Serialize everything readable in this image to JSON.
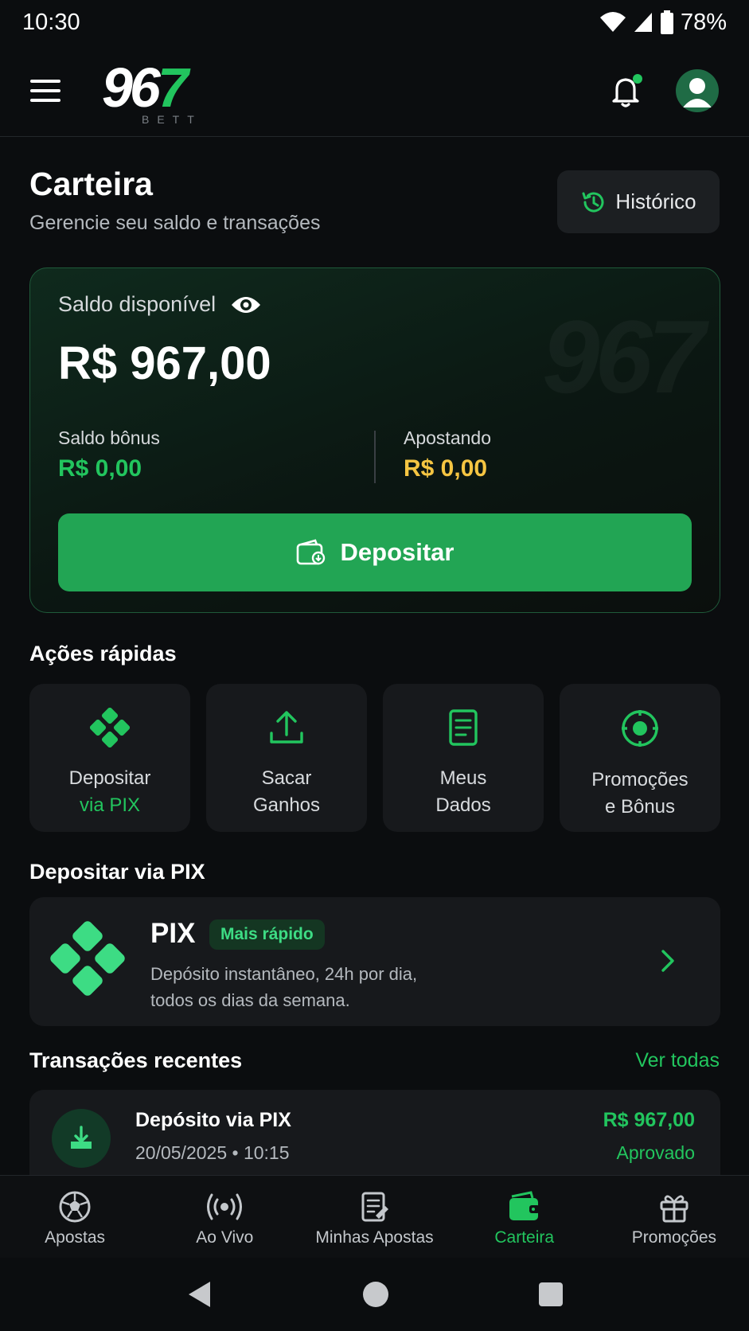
{
  "status_bar": {
    "time": "10:30",
    "battery": "78%"
  },
  "header": {
    "logo_number": "96",
    "logo_accent": "7",
    "logo_sub": "BETT"
  },
  "page": {
    "title": "Carteira",
    "subtitle": "Gerencie seu saldo e transações",
    "history_label": "Histórico"
  },
  "balance": {
    "label": "Saldo disponível",
    "value": "R$ 967,00",
    "watermark": "967",
    "bonus_label": "Saldo bônus",
    "bonus_value": "R$ 0,00",
    "betting_label": "Apostando",
    "betting_value": "R$ 0,00",
    "deposit_label": "Depositar"
  },
  "quick_actions": {
    "title": "Ações rápidas",
    "items": [
      {
        "line1": "Depositar",
        "line2": "via PIX",
        "icon": "pix-icon"
      },
      {
        "line1": "Sacar",
        "line2": "Ganhos",
        "icon": "upload-icon"
      },
      {
        "line1": "Meus",
        "line2": "Dados",
        "icon": "document-icon"
      },
      {
        "line1": "Promoções",
        "line2": "e Bônus",
        "icon": "target-icon"
      }
    ]
  },
  "pix": {
    "section_title": "Depositar via PIX",
    "title": "PIX",
    "badge": "Mais rápido",
    "desc_line1": "Depósito instantâneo, 24h por dia,",
    "desc_line2": "todos os dias da semana."
  },
  "transactions": {
    "title": "Transações recentes",
    "see_all": "Ver todas",
    "items": [
      {
        "title": "Depósito via PIX",
        "date": "20/05/2025 • 10:15",
        "amount": "R$ 967,00",
        "status": "Aprovado"
      }
    ]
  },
  "bottom_nav": {
    "items": [
      {
        "label": "Apostas"
      },
      {
        "label": "Ao Vivo"
      },
      {
        "label": "Minhas Apostas"
      },
      {
        "label": "Carteira"
      },
      {
        "label": "Promoções"
      }
    ],
    "active_index": 3
  },
  "colors": {
    "accent": "#22c55e",
    "button": "#22a554",
    "gold": "#f5c542",
    "background": "#0b0d0f",
    "card": "#17191c"
  }
}
